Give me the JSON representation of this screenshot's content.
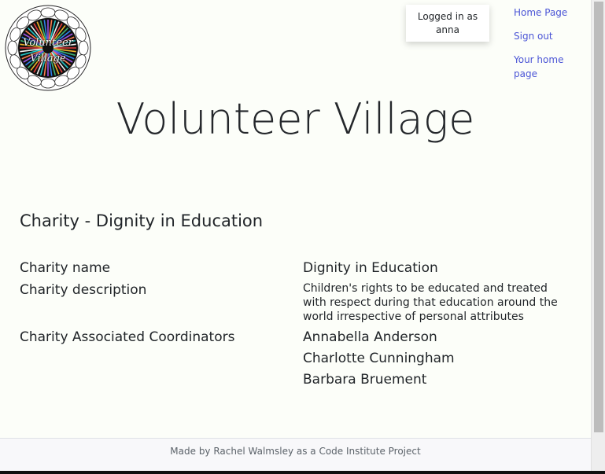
{
  "logo": {
    "line1": "Volunteer",
    "line2": "Village"
  },
  "login": {
    "status_line1": "Logged in as",
    "username": "anna"
  },
  "nav": {
    "home": "Home Page",
    "signout": "Sign out",
    "your_home": "Your home page"
  },
  "site_title": "Volunteer Village",
  "charity": {
    "heading": "Charity - Dignity in Education",
    "name_label": "Charity name",
    "name_value": "Dignity in Education",
    "description_label": "Charity description",
    "description_value": "Children's rights to be educated and treated with respect during that education around the world irrespective of personal attributes",
    "coordinators_label": "Charity Associated Coordinators",
    "coordinators": [
      "Annabella Anderson",
      "Charlotte Cunningham",
      "Barbara Bruement"
    ]
  },
  "footer": {
    "text": "Made by Rachel Walmsley as a Code Institute Project"
  },
  "colors": {
    "background": "#fcfef9",
    "link": "#4b55d6",
    "footer_bg": "#f8f8fa"
  }
}
